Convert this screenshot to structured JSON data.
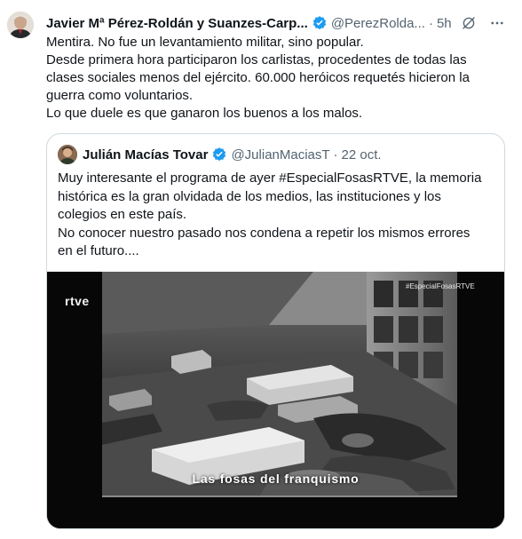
{
  "tweet": {
    "author_name": "Javier Mª Pérez-Roldán y Suanzes-Carp...",
    "handle": "@PerezRolda...",
    "separator": "·",
    "time": "5h",
    "lines": [
      "Mentira. No fue un levantamiento militar, sino popular.",
      "Desde primera hora participaron los carlistas, procedentes de todas las",
      "clases sociales menos del ejército. 60.000 heróicos requetés hicieron la",
      "guerra como voluntarios.",
      "Lo que duele es que ganaron los buenos a los malos."
    ]
  },
  "quote": {
    "author_name": "Julián Macías Tovar",
    "handle": "@JulianMaciasT",
    "separator": "·",
    "date": "22 oct.",
    "lines": [
      "Muy interesante el programa de ayer #EspecialFosasRTVE, la memoria",
      "histórica es la gran olvidada de los medios, las instituciones y los",
      "colegios en este país.",
      "No conocer nuestro pasado nos condena a repetir los mismos errores",
      "en el futuro...."
    ],
    "media": {
      "logo_text": "rtve",
      "hashtag": "#EspecialFosasRTVE",
      "caption": "Las fosas del franquismo"
    }
  },
  "colors": {
    "verified_blue": "#1d9bf0",
    "text_primary": "#0f1419",
    "text_secondary": "#536471",
    "border": "#cfd9de"
  },
  "icons": [
    "verified-badge-icon",
    "grok-icon",
    "more-icon"
  ]
}
